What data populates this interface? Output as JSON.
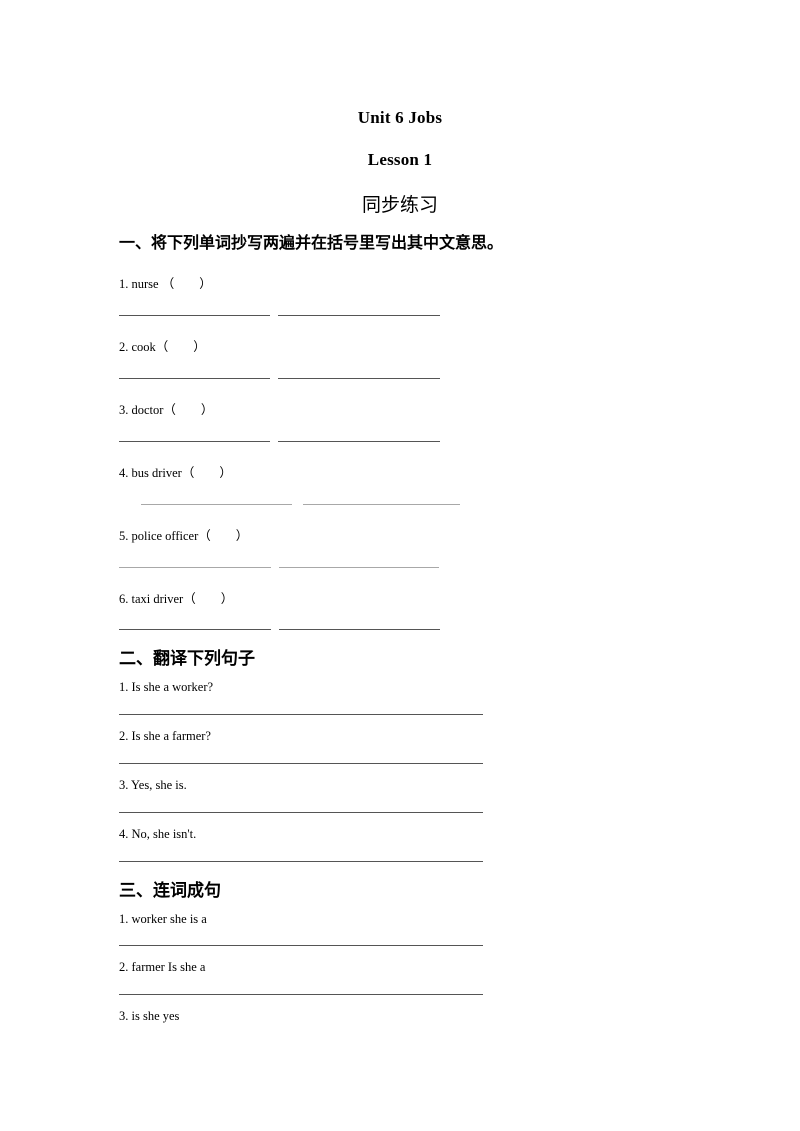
{
  "document": {
    "title_unit": "Unit 6 Jobs",
    "title_lesson": "Lesson 1",
    "subtitle": "同步练习"
  },
  "sections": [
    {
      "heading": "一、将下列单词抄写两遍并在括号里写出其中文意思。",
      "items": [
        "1. nurse （        ）",
        "2. cook（        ）",
        "3. doctor（        ）",
        "4. bus driver（        ）",
        "5. police officer（        ）",
        "6. taxi driver（        ）"
      ]
    },
    {
      "heading": "二、翻译下列句子",
      "items": [
        "1. Is she a worker?",
        "2. Is she a farmer?",
        "3. Yes, she is.",
        "4. No, she isn't."
      ]
    },
    {
      "heading": "三、连词成句",
      "items": [
        "1. worker she is a",
        "2. farmer Is she a",
        "3. is she yes"
      ]
    }
  ]
}
